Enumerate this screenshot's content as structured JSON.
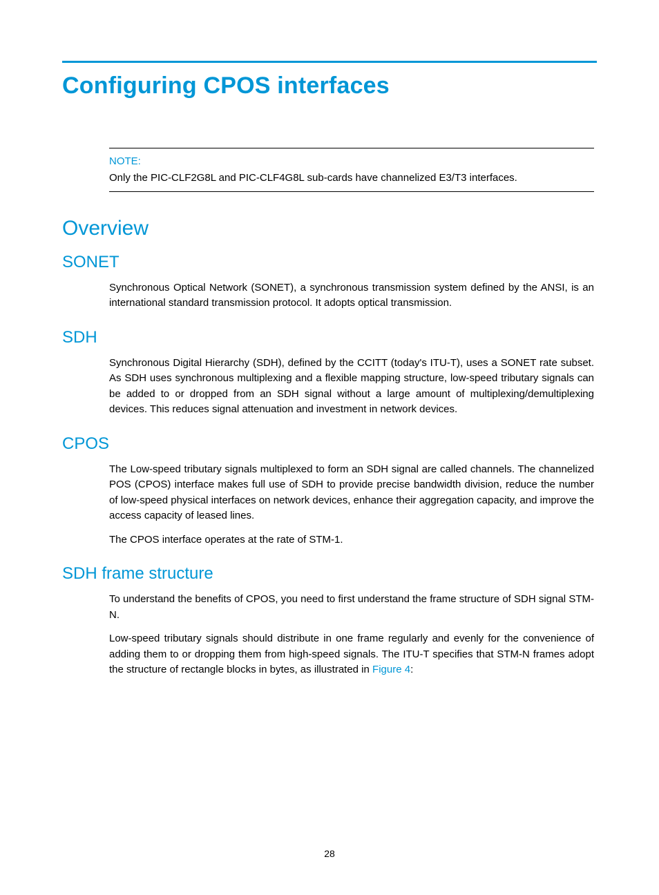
{
  "title": "Configuring CPOS interfaces",
  "note": {
    "label": "NOTE:",
    "text": "Only the PIC-CLF2G8L and PIC-CLF4G8L sub-cards have channelized E3/T3 interfaces."
  },
  "overview": {
    "heading": "Overview"
  },
  "sections": {
    "sonet": {
      "heading": "SONET",
      "p1": "Synchronous Optical Network (SONET), a synchronous transmission system defined by the ANSI, is an international standard transmission protocol. It adopts optical transmission."
    },
    "sdh": {
      "heading": "SDH",
      "p1": "Synchronous Digital Hierarchy (SDH), defined by the CCITT (today's ITU-T), uses a SONET rate subset. As SDH uses synchronous multiplexing and a flexible mapping structure, low-speed tributary signals can be added to or dropped from an SDH signal without a large amount of multiplexing/demultiplexing devices. This reduces signal attenuation and investment in network devices."
    },
    "cpos": {
      "heading": "CPOS",
      "p1": "The Low-speed tributary signals multiplexed to form an SDH signal are called channels. The channelized POS (CPOS) interface makes full use of SDH to provide precise bandwidth division, reduce the number of low-speed physical interfaces on network devices, enhance their aggregation capacity, and improve the access capacity of leased lines.",
      "p2": "The CPOS interface operates at the rate of STM-1."
    },
    "sdhframe": {
      "heading": "SDH frame structure",
      "p1": "To understand the benefits of CPOS, you need to first understand the frame structure of SDH signal STM-N.",
      "p2_pre": "Low-speed tributary signals should distribute in one frame regularly and evenly for the convenience of adding them to or dropping them from high-speed signals. The ITU-T specifies that STM-N frames adopt the structure of rectangle blocks in bytes, as illustrated in ",
      "p2_link": "Figure 4",
      "p2_post": ":"
    }
  },
  "pageNumber": "28"
}
